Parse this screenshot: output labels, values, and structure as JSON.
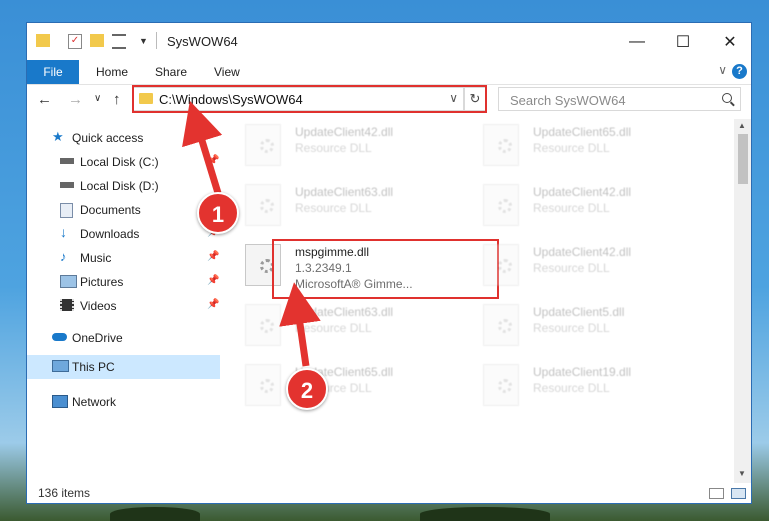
{
  "window": {
    "title": "SysWOW64",
    "controls": {
      "minimize": "—",
      "maximize": "☐",
      "close": "✕"
    }
  },
  "ribbon": {
    "file": "File",
    "tabs": [
      "Home",
      "Share",
      "View"
    ],
    "help": "?",
    "collapse": "∨"
  },
  "nav": {
    "back": "←",
    "forward": "→",
    "recent": "∨",
    "up": "↑",
    "address": "C:\\Windows\\SysWOW64",
    "address_chevron": "∨",
    "refresh": "↻",
    "search_placeholder": "Search SysWOW64"
  },
  "sidebar": {
    "items": [
      {
        "label": "Quick access",
        "icon": "star-icon",
        "pinned": false
      },
      {
        "label": "Local Disk (C:)",
        "icon": "drive-icon",
        "pinned": true
      },
      {
        "label": "Local Disk (D:)",
        "icon": "drive-icon",
        "pinned": true
      },
      {
        "label": "Documents",
        "icon": "documents-icon",
        "pinned": true
      },
      {
        "label": "Downloads",
        "icon": "download-icon",
        "pinned": true
      },
      {
        "label": "Music",
        "icon": "music-icon",
        "pinned": true
      },
      {
        "label": "Pictures",
        "icon": "pictures-icon",
        "pinned": true
      },
      {
        "label": "Videos",
        "icon": "videos-icon",
        "pinned": true
      },
      {
        "label": "OneDrive",
        "icon": "cloud-icon",
        "pinned": false
      },
      {
        "label": "This PC",
        "icon": "computer-icon",
        "pinned": false,
        "selected": true
      },
      {
        "label": "Network",
        "icon": "network-icon",
        "pinned": false
      }
    ],
    "pin_glyph": "📌"
  },
  "files": {
    "left": [
      {
        "name": "UpdateClient42.dll",
        "type": "Resource DLL"
      },
      {
        "name": "UpdateClient63.dll",
        "type": "Resource DLL"
      },
      {
        "name": "mspgimme.dll",
        "version": "1.3.2349.1",
        "company": "MicrosoftA® Gimme..."
      },
      {
        "name": "UpdateClient63.dll",
        "type": "Resource DLL"
      },
      {
        "name": "UpdateClient65.dll",
        "type": "Resource DLL"
      }
    ],
    "right": [
      {
        "name": "UpdateClient65.dll",
        "type": "Resource DLL"
      },
      {
        "name": "UpdateClient42.dll",
        "type": "Resource DLL"
      },
      {
        "name": "UpdateClient42.dll",
        "type": "Resource DLL"
      },
      {
        "name": "UpdateClient5.dll",
        "type": "Resource DLL"
      },
      {
        "name": "UpdateClient19.dll",
        "type": "Resource DLL"
      }
    ]
  },
  "status": {
    "items": "136 items"
  },
  "callouts": {
    "one": "1",
    "two": "2"
  },
  "colors": {
    "accent": "#1979ca",
    "highlight": "#e0312e",
    "selection": "#cce8ff"
  }
}
